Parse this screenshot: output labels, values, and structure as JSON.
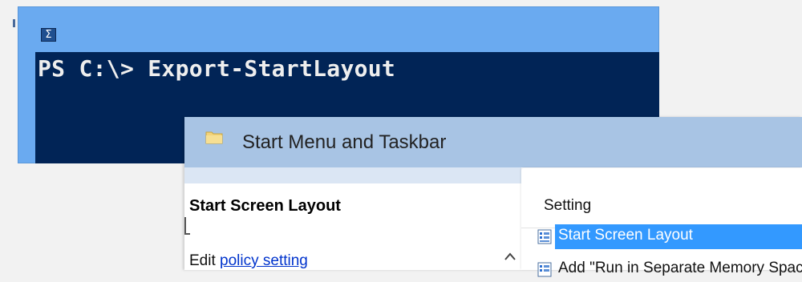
{
  "powershell": {
    "icon": "powershell-icon",
    "command_line": "PS C:\\> Export-StartLayout",
    "colors": {
      "title_bar": "#6aaaf0",
      "console_bg": "#012456",
      "console_text": "#eeeeee"
    }
  },
  "gpedit": {
    "title": "Start Menu and Taskbar",
    "title_icon": "folder-icon",
    "left_pane": {
      "heading": "Start Screen Layout",
      "edit_prefix": "Edit",
      "edit_link": "policy setting"
    },
    "list": {
      "column_header": "Setting",
      "rows": [
        {
          "label": "Start Screen Layout",
          "icon": "policy-setting-icon",
          "selected": true
        },
        {
          "label": "Add \"Run in Separate Memory Space\"",
          "icon": "policy-setting-icon",
          "selected": false
        }
      ]
    },
    "colors": {
      "title_bar": "#a8c4e4",
      "selection": "#3399ff",
      "link": "#0033cc"
    }
  }
}
